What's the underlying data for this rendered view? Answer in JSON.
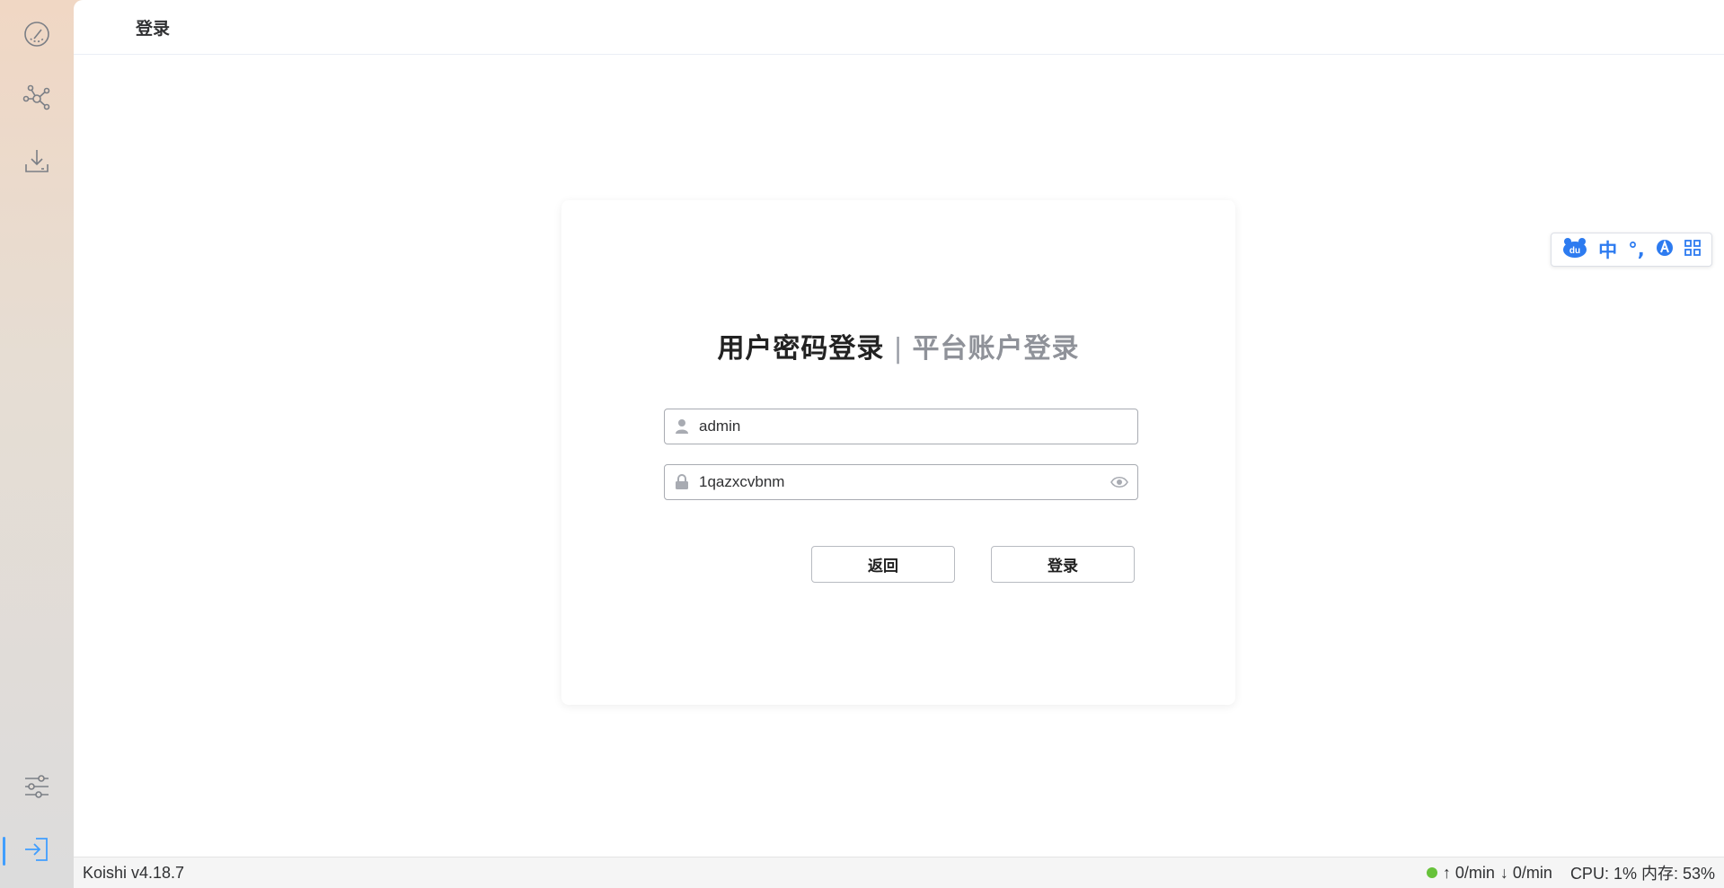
{
  "activity_bar": {
    "top_items": [
      {
        "icon": "dashboard-icon"
      },
      {
        "icon": "network-icon"
      },
      {
        "icon": "download-icon"
      }
    ],
    "bottom_items": [
      {
        "icon": "settings-sliders-icon"
      },
      {
        "icon": "login-icon",
        "active": true
      }
    ]
  },
  "header": {
    "title": "登录"
  },
  "login": {
    "tab_active": "用户密码登录",
    "tab_separator": "|",
    "tab_inactive": "平台账户登录",
    "username": {
      "value": "admin",
      "icon": "user-icon"
    },
    "password": {
      "value": "1qazxcvbnm",
      "icon": "lock-icon",
      "toggle_icon": "eye-icon"
    },
    "back_label": "返回",
    "submit_label": "登录"
  },
  "ime_toolbar": {
    "items": [
      "du",
      "中",
      "°,",
      "A",
      "grid"
    ]
  },
  "statusbar": {
    "version": "Koishi v4.18.7",
    "status_color": "#67c23a",
    "upload": "↑ 0/min",
    "download": "↓ 0/min",
    "cpu_memory": "CPU: 1%  内存: 53%"
  },
  "colors": {
    "accent": "#409eff",
    "ime_blue": "#2d7bf0"
  }
}
